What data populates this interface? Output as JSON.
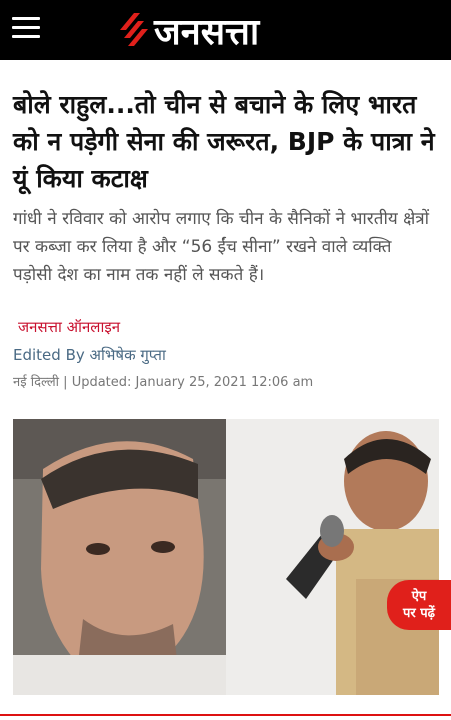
{
  "brand": {
    "name": "जनसत्ता",
    "accent": "#e0201b"
  },
  "article": {
    "headline": "बोले राहुल...तो चीन से बचाने के लिए भारत को न पड़ेगी सेना की जरूरत, BJP के पात्रा ने यूं किया कटाक्ष",
    "summary": "गांधी ने रविवार को आरोप लगाए कि चीन के सैनिकों ने भारतीय क्षेत्रों पर कब्जा कर लिया है और “56 ईंच सीना” रखने वाले व्यक्ति पड़ोसी देश का नाम तक नहीं ले सकते हैं।",
    "source": "जनसत्ता ऑनलाइन",
    "byline_label": "Edited By",
    "author": "अभिषेक गुप्ता",
    "dateline": "नई दिल्ली | Updated: January 25, 2021 12:06 am"
  },
  "app_badge": {
    "line1": "ऐप",
    "line2": "पर पढ़ें"
  },
  "icons": {
    "menu": "hamburger-menu-icon",
    "logo": "jansatta-logo-icon"
  }
}
